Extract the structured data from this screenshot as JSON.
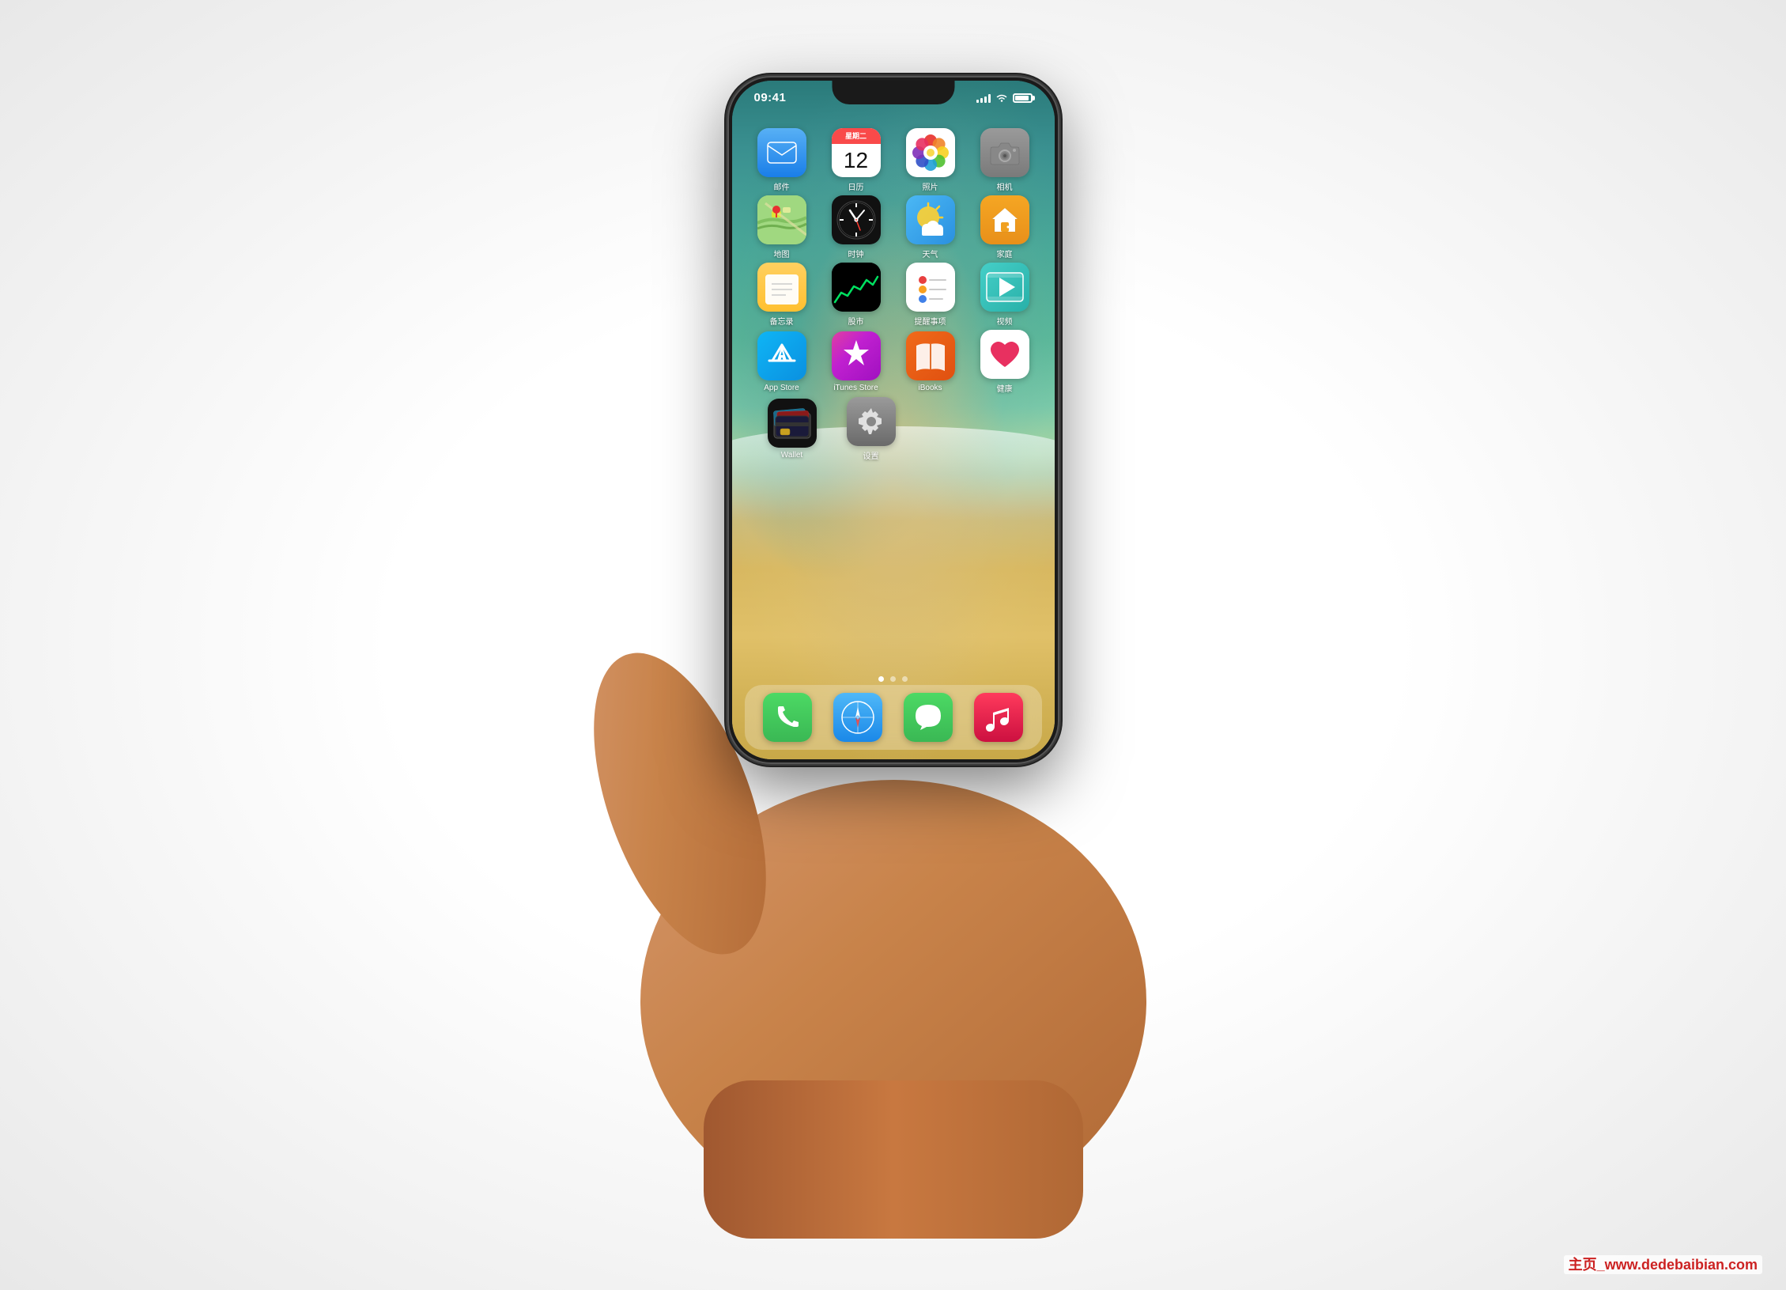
{
  "page": {
    "background": "#efefef",
    "watermark": "主页_www.dedebaibian.com"
  },
  "status_bar": {
    "time": "09:41",
    "signal_bars": 4,
    "wifi": true,
    "battery": 90
  },
  "screen": {
    "wallpaper": "beach-ocean-sand"
  },
  "apps": {
    "row1": [
      {
        "id": "mail",
        "label": "邮件",
        "icon_type": "mail"
      },
      {
        "id": "calendar",
        "label": "日历",
        "icon_type": "calendar",
        "date": "12",
        "day": "星期二"
      },
      {
        "id": "photos",
        "label": "照片",
        "icon_type": "photos"
      },
      {
        "id": "camera",
        "label": "相机",
        "icon_type": "camera"
      }
    ],
    "row2": [
      {
        "id": "maps",
        "label": "地图",
        "icon_type": "maps"
      },
      {
        "id": "clock",
        "label": "时钟",
        "icon_type": "clock"
      },
      {
        "id": "weather",
        "label": "天气",
        "icon_type": "weather"
      },
      {
        "id": "home",
        "label": "家庭",
        "icon_type": "home"
      }
    ],
    "row3": [
      {
        "id": "notes",
        "label": "备忘录",
        "icon_type": "notes"
      },
      {
        "id": "stocks",
        "label": "股市",
        "icon_type": "stocks"
      },
      {
        "id": "reminders",
        "label": "提醒事项",
        "icon_type": "reminders"
      },
      {
        "id": "videos",
        "label": "视频",
        "icon_type": "videos"
      }
    ],
    "row4": [
      {
        "id": "appstore",
        "label": "App Store",
        "icon_type": "appstore"
      },
      {
        "id": "itunes",
        "label": "iTunes Store",
        "icon_type": "itunes"
      },
      {
        "id": "ibooks",
        "label": "iBooks",
        "icon_type": "ibooks"
      },
      {
        "id": "health",
        "label": "健康",
        "icon_type": "health"
      }
    ],
    "row5": [
      {
        "id": "wallet",
        "label": "Wallet",
        "icon_type": "wallet"
      },
      {
        "id": "settings",
        "label": "设置",
        "icon_type": "settings"
      }
    ]
  },
  "dock": [
    {
      "id": "phone",
      "label": "电话",
      "icon_type": "phone"
    },
    {
      "id": "safari",
      "label": "Safari",
      "icon_type": "safari"
    },
    {
      "id": "messages",
      "label": "信息",
      "icon_type": "messages"
    },
    {
      "id": "music",
      "label": "音乐",
      "icon_type": "music"
    }
  ],
  "page_dots": [
    {
      "active": true
    },
    {
      "active": false
    },
    {
      "active": false
    }
  ]
}
